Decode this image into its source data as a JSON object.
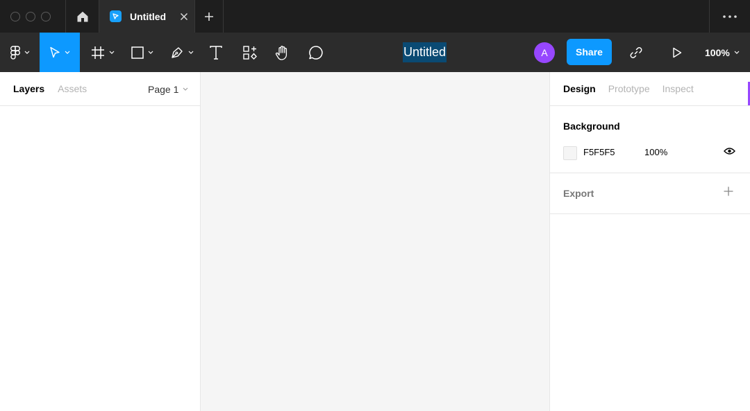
{
  "titlebar": {
    "tab": {
      "label": "Untitled"
    }
  },
  "toolbar": {
    "document_title": "Untitled",
    "avatar_initial": "A",
    "share_label": "Share",
    "zoom_level": "100%",
    "accent_color": "#0d99ff"
  },
  "left_panel": {
    "tabs": [
      {
        "label": "Layers",
        "active": true
      },
      {
        "label": "Assets",
        "active": false
      }
    ],
    "page_select": "Page 1"
  },
  "right_panel": {
    "tabs": [
      {
        "label": "Design",
        "active": true
      },
      {
        "label": "Prototype",
        "active": false
      },
      {
        "label": "Inspect",
        "active": false
      }
    ],
    "background": {
      "title": "Background",
      "hex": "F5F5F5",
      "opacity": "100%"
    },
    "export": {
      "title": "Export"
    }
  },
  "canvas": {
    "background_color": "#f5f5f5"
  }
}
